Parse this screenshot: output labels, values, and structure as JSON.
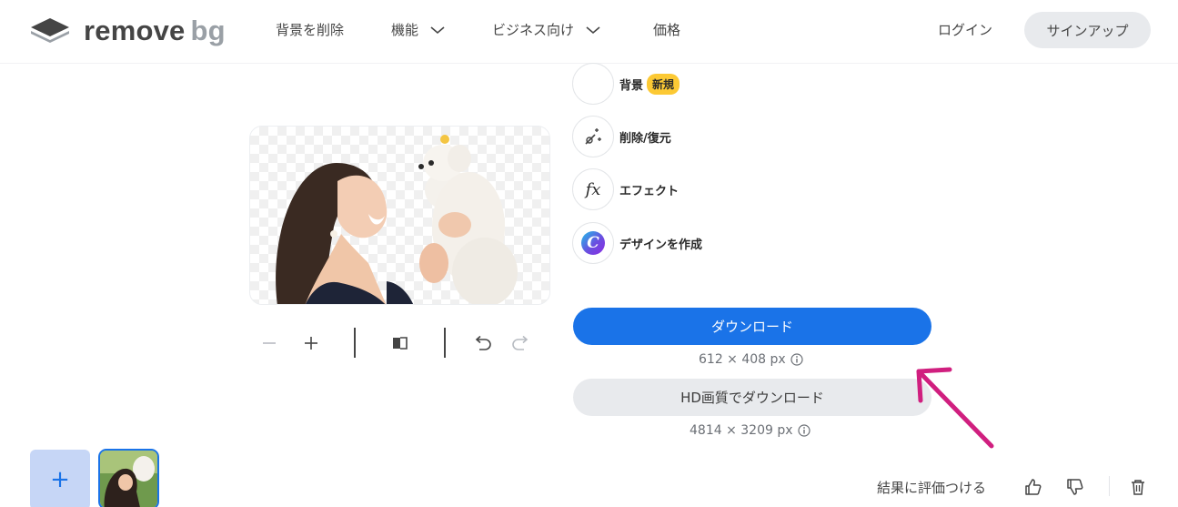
{
  "header": {
    "logo": {
      "text": "remove",
      "text_accent": "bg"
    },
    "nav": {
      "remove_bg": "背景を削除",
      "features": "機能",
      "business": "ビジネス向け",
      "pricing": "価格"
    },
    "login": "ログイン",
    "signup": "サインアップ"
  },
  "editor": {
    "toolbar": {
      "icons": [
        "zoom-out-icon",
        "zoom-in-icon",
        "compare-icon",
        "undo-icon",
        "redo-icon"
      ]
    }
  },
  "tools": {
    "background": {
      "label": "背景",
      "badge": "新規"
    },
    "erase_restore": {
      "label": "削除/復元"
    },
    "effects": {
      "label": "エフェクト",
      "icon_text": "fx"
    },
    "design": {
      "label": "デザインを作成",
      "icon_text": "C"
    }
  },
  "download": {
    "label": "ダウンロード",
    "size": "612 × 408 px",
    "hd_label": "HD画質でダウンロード",
    "hd_size": "4814 × 3209 px"
  },
  "footer": {
    "add_label": "+",
    "rate_label": "結果に評価つける"
  },
  "colors": {
    "primary": "#1a73e8",
    "badge": "#fcc934",
    "arrow": "#d01f7f",
    "text": "#454545"
  }
}
